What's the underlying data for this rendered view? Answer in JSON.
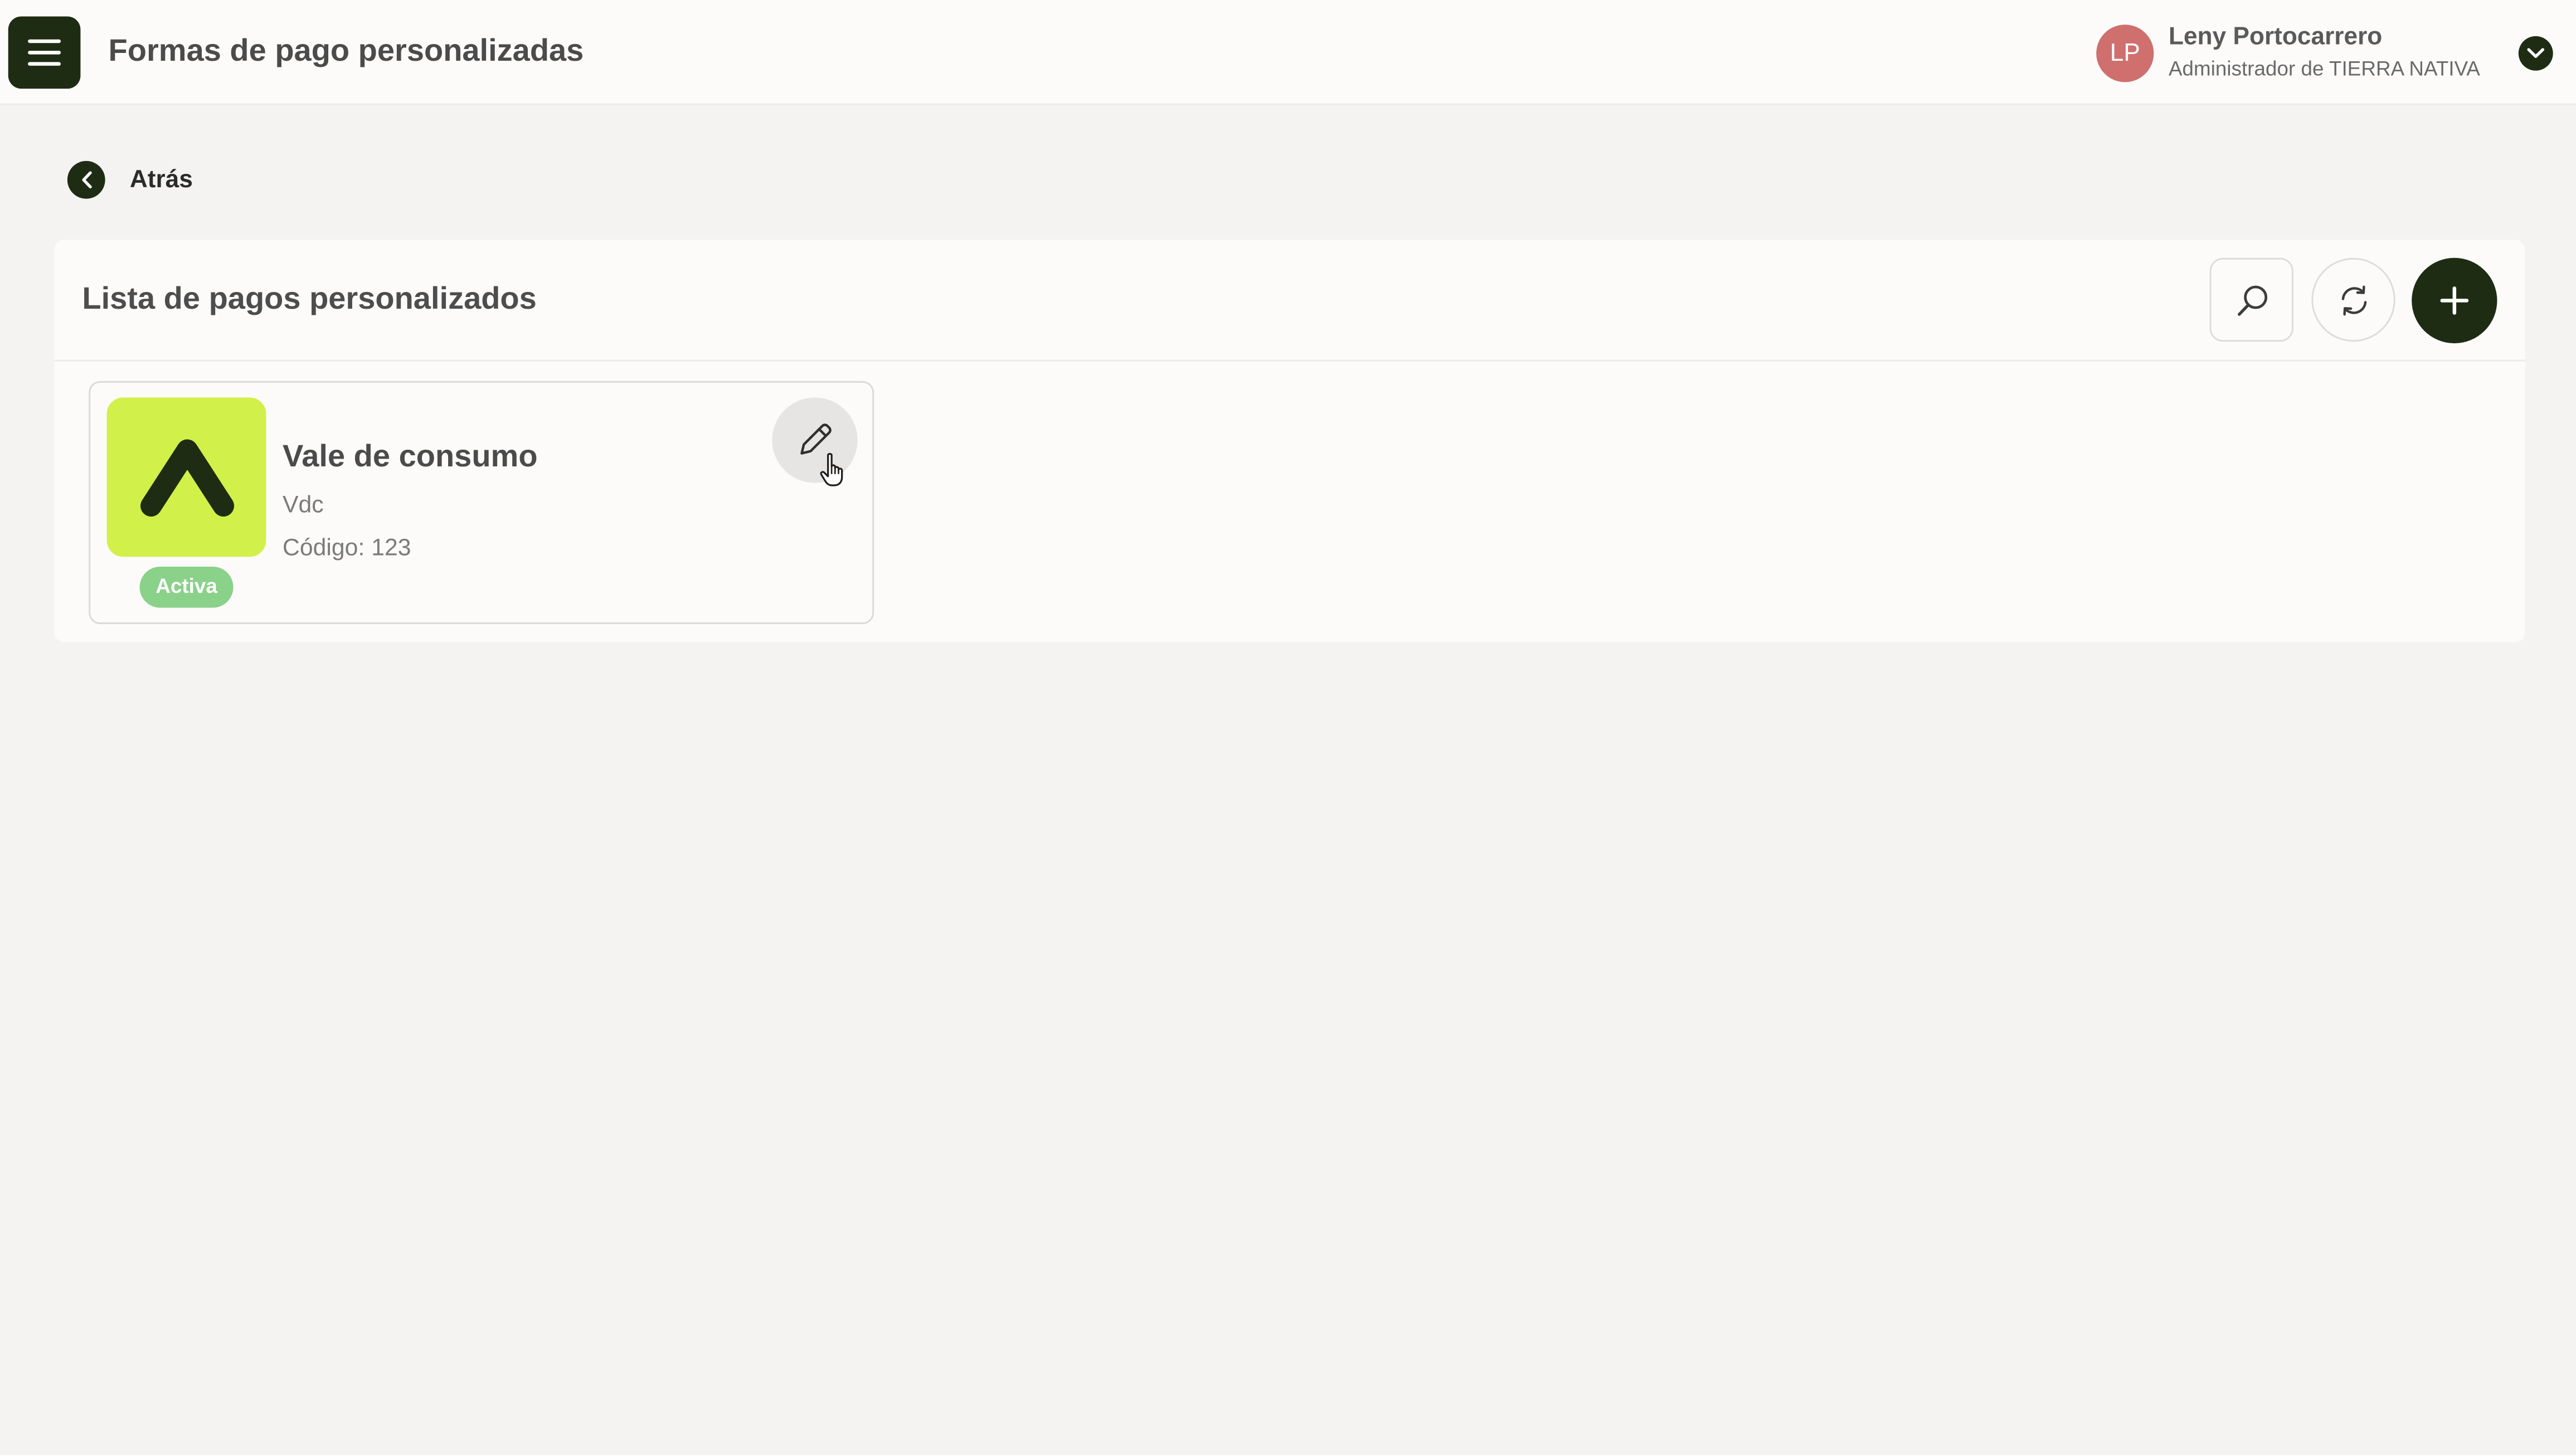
{
  "app": {
    "page_title": "Formas de pago personalizadas",
    "menu_icon": "hamburger-menu-icon"
  },
  "user": {
    "initials": "LP",
    "name": "Leny Portocarrero",
    "role": "Administrador de TIERRA NATIVA",
    "avatar_color": "#cf6f6e",
    "toggle_icon": "chevron-down-icon"
  },
  "navigation": {
    "back_label": "Atrás",
    "back_icon": "chevron-left-icon"
  },
  "panel": {
    "title": "Lista de pagos personalizados",
    "actions": {
      "search_icon": "search-icon",
      "refresh_icon": "refresh-icon",
      "add_icon": "plus-icon"
    }
  },
  "payment_methods": [
    {
      "name": "Vale de consumo",
      "code": "Vdc",
      "number_label": "Código: 123",
      "status": "Activa",
      "logo_icon": "brand-logo-icon",
      "edit_icon": "pencil-icon"
    }
  ],
  "colors": {
    "primary_dark": "#1e2c14",
    "logo_background": "#d2f04a",
    "status_active": "#8ad18a",
    "page_background": "#f4f3f2",
    "surface": "#fcfbfa"
  }
}
